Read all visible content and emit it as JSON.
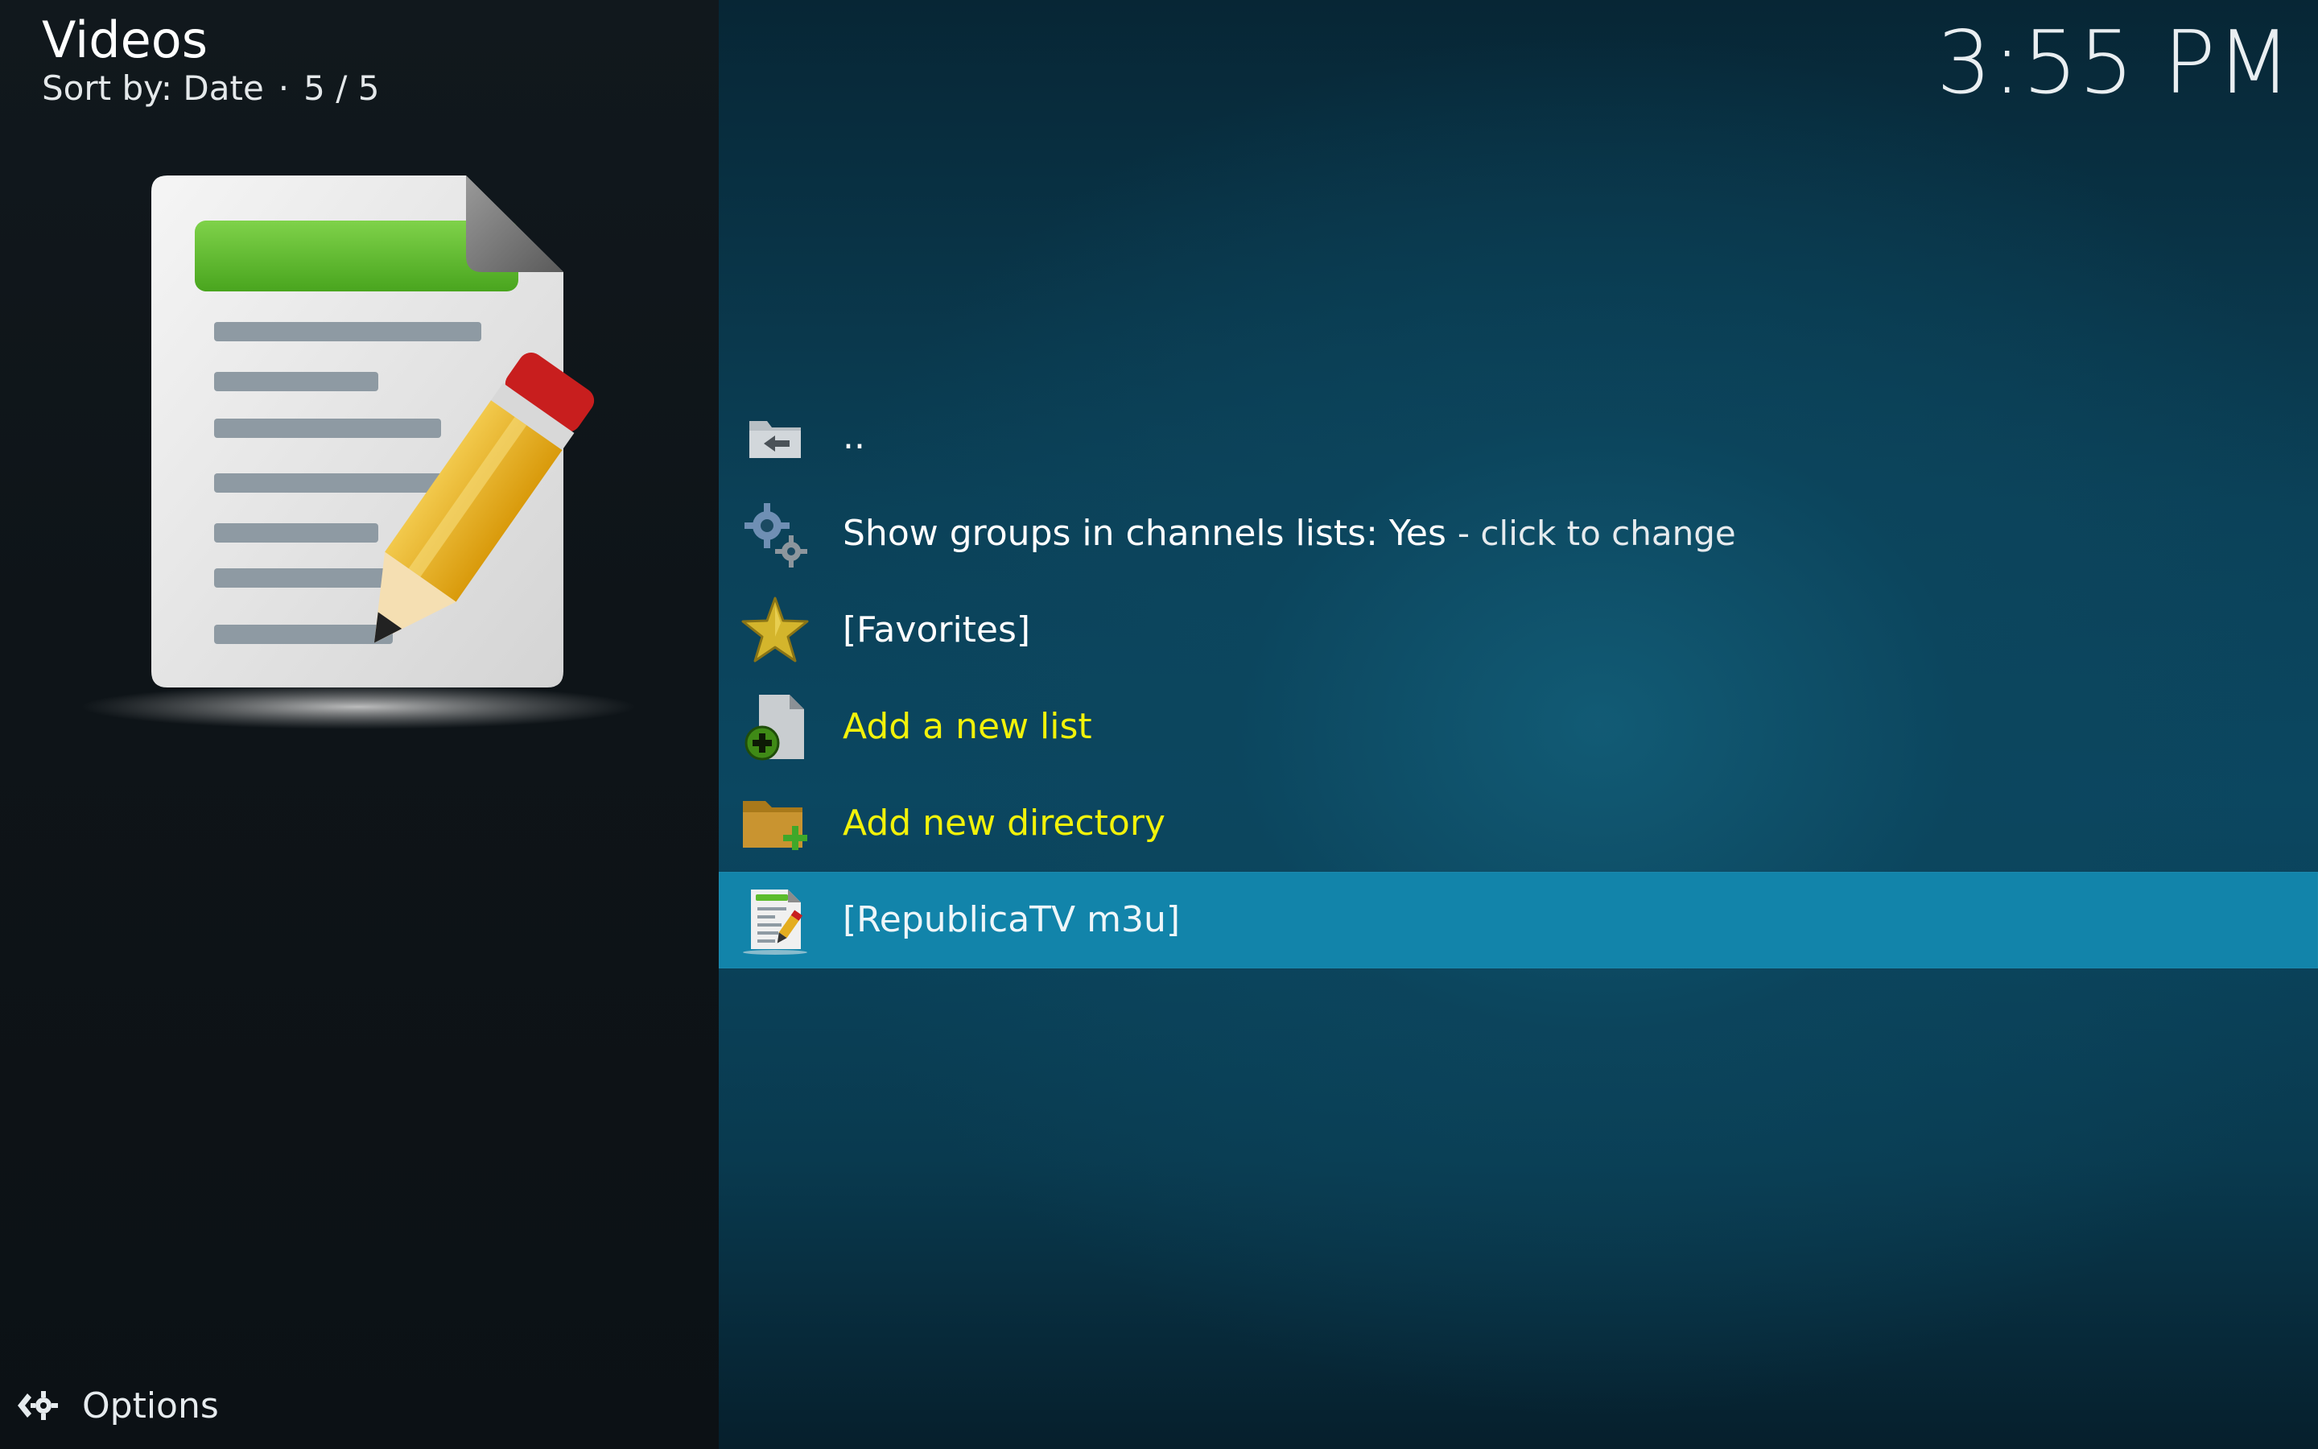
{
  "header": {
    "title": "Videos",
    "sort_label": "Sort by: Date",
    "separator": "·",
    "count": "5 / 5"
  },
  "clock": "3:55 PM",
  "thumbnail": {
    "icon": "document-edit-icon"
  },
  "list": {
    "items": [
      {
        "label": "..",
        "icon": "folder-back-icon",
        "color": "#ffffff"
      },
      {
        "label": "Show groups in channels lists: Yes",
        "suffix": "- click to change",
        "icon": "settings-gears-icon",
        "color": "#ffffff"
      },
      {
        "label": "[Favorites]",
        "icon": "star-icon",
        "color": "#ffffff"
      },
      {
        "label": "Add a new list",
        "icon": "add-file-icon",
        "color": "#f2f20a"
      },
      {
        "label": "Add new directory",
        "icon": "add-folder-icon",
        "color": "#f2f20a"
      },
      {
        "label": "[RepublicaTV m3u]",
        "icon": "document-edit-icon",
        "color": "#eef6f9",
        "selected": true
      }
    ]
  },
  "footer": {
    "options_label": "Options",
    "options_icon": "options-gear-icon"
  },
  "colors": {
    "selected_row": "#1284aa",
    "accent_yellow": "#f2f20a"
  }
}
